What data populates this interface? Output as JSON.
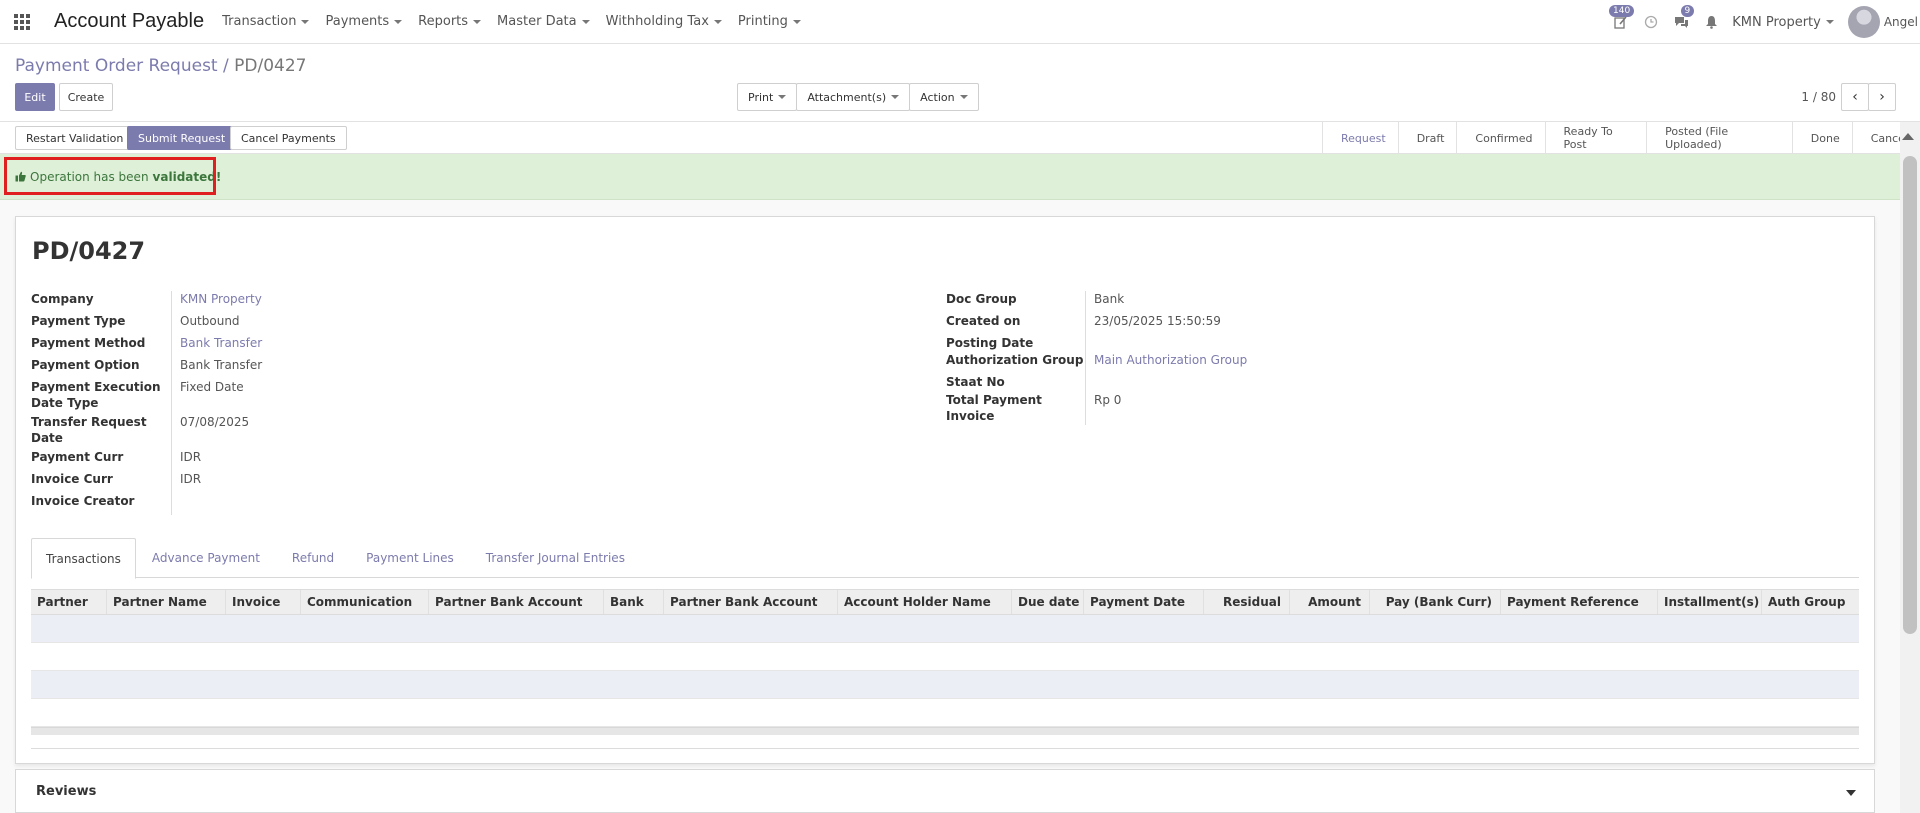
{
  "navbar": {
    "brand": "Account Payable",
    "menu": [
      "Transaction",
      "Payments",
      "Reports",
      "Master Data",
      "Withholding Tax",
      "Printing"
    ],
    "activity_badge": "140",
    "messages_badge": "9",
    "company": "KMN Property",
    "user": "Angel"
  },
  "control_panel": {
    "breadcrumb_parent": "Payment Order Request",
    "breadcrumb_sep": "/",
    "breadcrumb_current": "PD/0427",
    "edit_label": "Edit",
    "create_label": "Create",
    "print_label": "Print",
    "attachments_label": "Attachment(s)",
    "action_label": "Action",
    "pager": "1 / 80",
    "prev_icon": "‹",
    "next_icon": "›"
  },
  "statusbar": {
    "restart_label": "Restart Validation",
    "submit_label": "Submit Request",
    "cancel_label": "Cancel Payments",
    "stages": [
      "Request",
      "Draft",
      "Confirmed",
      "Ready To Post",
      "Posted (File Uploaded)",
      "Done",
      "Cancel"
    ],
    "active_stage": "Request"
  },
  "alert": {
    "icon": "thumbs-up-icon",
    "text": "Operation has been",
    "bold": "validated!"
  },
  "form": {
    "title": "PD/0427",
    "left": [
      {
        "label": "Company",
        "value": "KMN Property",
        "link": true
      },
      {
        "label": "Payment Type",
        "value": "Outbound",
        "link": false
      },
      {
        "label": "Payment Method",
        "value": "Bank Transfer",
        "link": true
      },
      {
        "label": "Payment Option",
        "value": "Bank Transfer",
        "link": false
      },
      {
        "label": "Payment Execution Date Type",
        "value": "Fixed Date",
        "link": false
      },
      {
        "label": "Transfer Request Date",
        "value": "07/08/2025",
        "link": false
      },
      {
        "label": "Payment Curr",
        "value": "IDR",
        "link": false
      },
      {
        "label": "Invoice Curr",
        "value": "IDR",
        "link": false
      },
      {
        "label": "Invoice Creator",
        "value": "",
        "link": false
      }
    ],
    "right": [
      {
        "label": "Doc Group",
        "value": "Bank",
        "link": false
      },
      {
        "label": "Created on",
        "value": "23/05/2025 15:50:59",
        "link": false
      },
      {
        "label": "Posting Date",
        "value": "",
        "link": false
      },
      {
        "label": "Authorization Group",
        "value": "Main Authorization Group",
        "link": true
      },
      {
        "label": "Staat No",
        "value": "",
        "link": false
      },
      {
        "label": "Total Payment Invoice",
        "value": "Rp 0",
        "link": false
      }
    ]
  },
  "tabs": [
    "Transactions",
    "Advance Payment",
    "Refund",
    "Payment Lines",
    "Transfer Journal Entries"
  ],
  "active_tab": "Transactions",
  "table": {
    "columns": [
      "Partner",
      "Partner Name",
      "Invoice",
      "Communication",
      "Partner Bank Account",
      "Bank",
      "Partner Bank Account",
      "Account Holder Name",
      "Due date",
      "Payment Date",
      "Residual",
      "Amount",
      "Pay (Bank Curr)",
      "Payment Reference",
      "Installment(s)",
      "Auth Group"
    ]
  },
  "reviews": {
    "title": "Reviews"
  }
}
